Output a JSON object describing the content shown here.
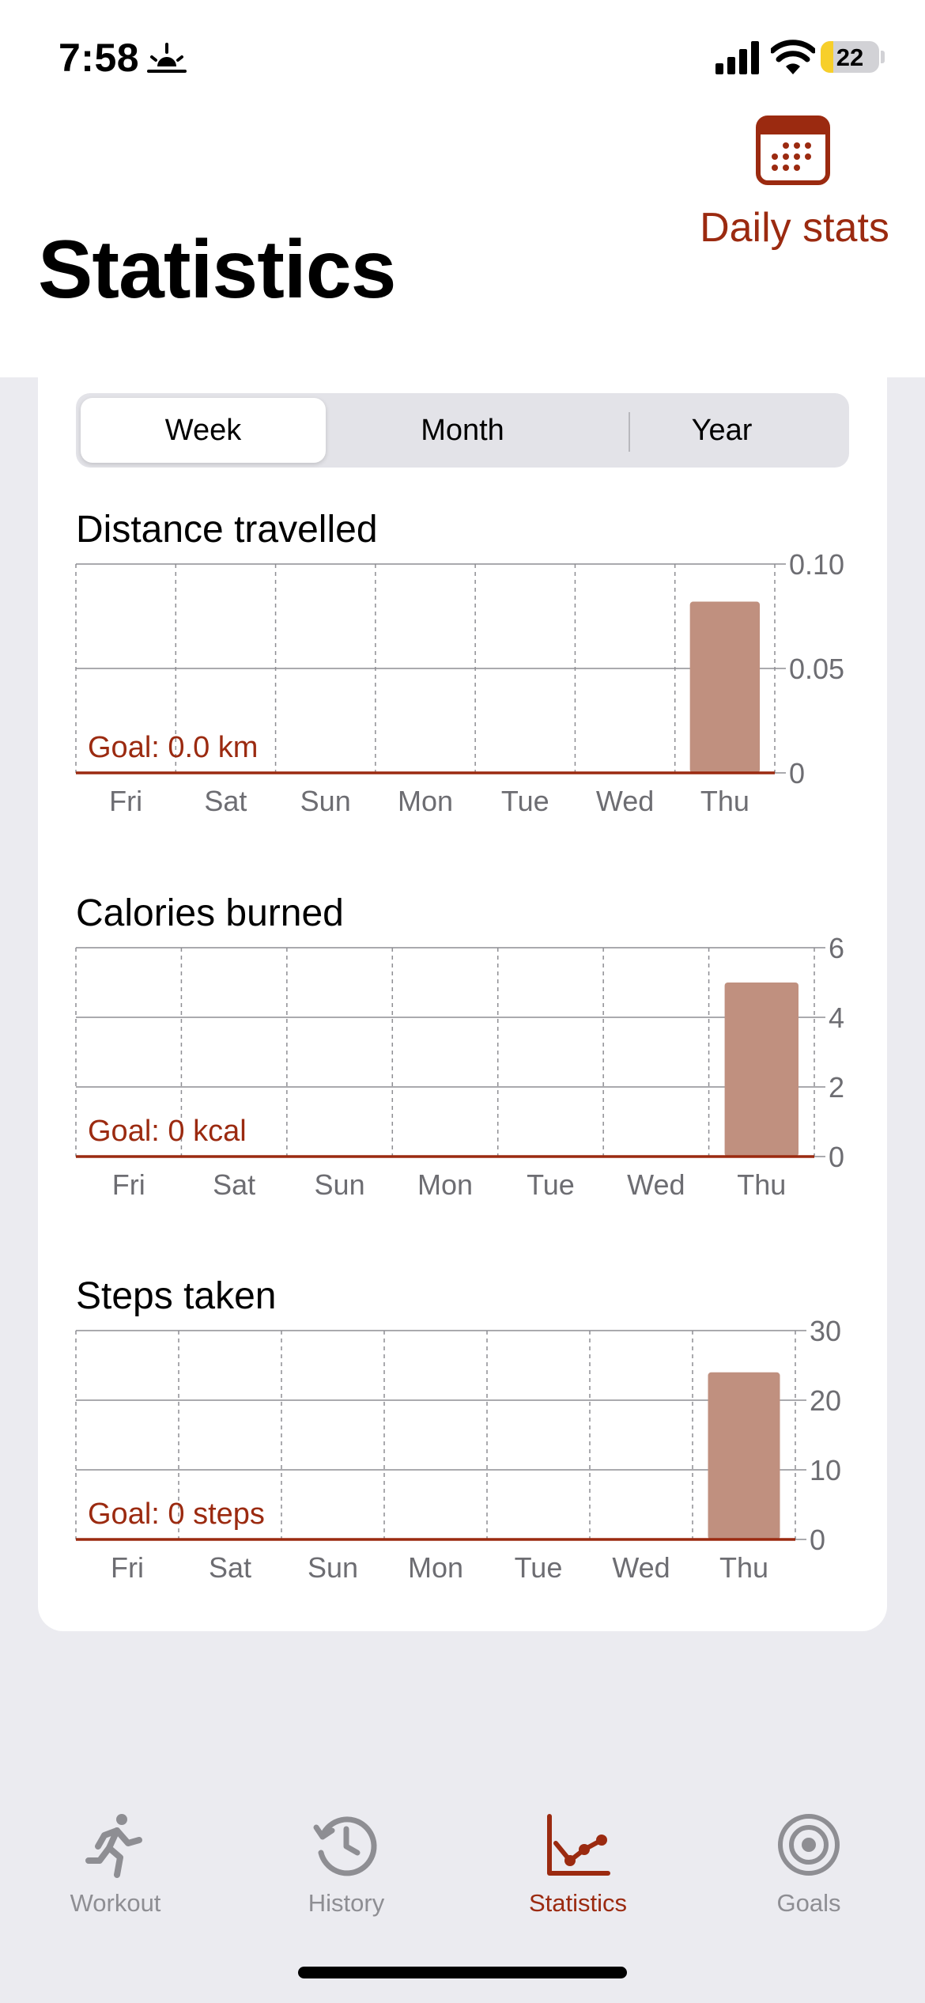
{
  "status_bar": {
    "time": "7:58",
    "battery": "22"
  },
  "header": {
    "daily_stats": "Daily stats",
    "title": "Statistics"
  },
  "segments": [
    {
      "label": "Week",
      "selected": true
    },
    {
      "label": "Month",
      "selected": false
    },
    {
      "label": "Year",
      "selected": false
    }
  ],
  "colors": {
    "accent": "#9b2a10",
    "bar": "#c0907f"
  },
  "chart_data": [
    {
      "type": "bar",
      "title": "Distance travelled",
      "categories": [
        "Fri",
        "Sat",
        "Sun",
        "Mon",
        "Tue",
        "Wed",
        "Thu"
      ],
      "values": [
        0,
        0,
        0,
        0,
        0,
        0,
        0.082
      ],
      "ylim": [
        0,
        0.1
      ],
      "yticks": [
        "0.10",
        "0.05",
        "0"
      ],
      "goal_label": "Goal: 0.0 km"
    },
    {
      "type": "bar",
      "title": "Calories burned",
      "categories": [
        "Fri",
        "Sat",
        "Sun",
        "Mon",
        "Tue",
        "Wed",
        "Thu"
      ],
      "values": [
        0,
        0,
        0,
        0,
        0,
        0,
        5
      ],
      "ylim": [
        0,
        6
      ],
      "yticks": [
        "6",
        "4",
        "2",
        "0"
      ],
      "goal_label": "Goal: 0 kcal"
    },
    {
      "type": "bar",
      "title": "Steps taken",
      "categories": [
        "Fri",
        "Sat",
        "Sun",
        "Mon",
        "Tue",
        "Wed",
        "Thu"
      ],
      "values": [
        0,
        0,
        0,
        0,
        0,
        0,
        24
      ],
      "ylim": [
        0,
        30
      ],
      "yticks": [
        "30",
        "20",
        "10",
        "0"
      ],
      "goal_label": "Goal: 0 steps"
    }
  ],
  "tabs": [
    {
      "label": "Workout",
      "icon": "running-figure-icon",
      "active": false
    },
    {
      "label": "History",
      "icon": "clock-history-icon",
      "active": false
    },
    {
      "label": "Statistics",
      "icon": "line-chart-icon",
      "active": true
    },
    {
      "label": "Goals",
      "icon": "target-icon",
      "active": false
    }
  ]
}
